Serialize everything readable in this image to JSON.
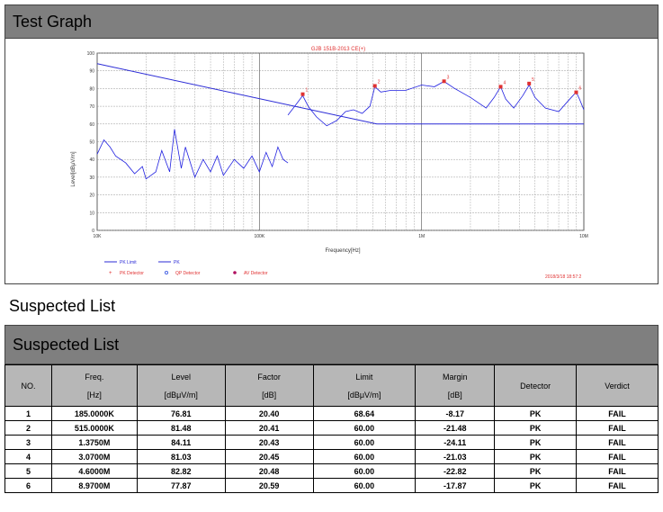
{
  "header": {
    "title": "Test Graph"
  },
  "chart_data": {
    "type": "line",
    "title": "GJB 151B-2013 CE(+)",
    "xlabel": "Frequency[Hz]",
    "ylabel": "Level[dBμV/m]",
    "xscale": "log",
    "xlim": [
      10000,
      10000000
    ],
    "ylim": [
      0,
      100
    ],
    "x_ticks": [
      10000,
      100000,
      1000000,
      10000000
    ],
    "x_tick_labels": [
      "10K",
      "100K",
      "1M",
      "10M"
    ],
    "y_ticks": [
      0,
      10,
      20,
      30,
      40,
      50,
      60,
      70,
      80,
      90,
      100
    ],
    "grid": true,
    "series": [
      {
        "name": "PK Limit",
        "color": "#2b2bd6",
        "x": [
          10000,
          530000,
          10000000
        ],
        "y": [
          94,
          60,
          60
        ]
      },
      {
        "name": "PK",
        "color": "#2020e0",
        "x": [
          10000,
          11000,
          12000,
          13000,
          15000,
          17000,
          19000,
          20000,
          23000,
          25000,
          28000,
          30000,
          33000,
          35000,
          40000,
          45000,
          50000,
          55000,
          60000,
          70000,
          80000,
          90000,
          100000,
          110000,
          120000,
          130000,
          140000,
          150000
        ],
        "y": [
          43,
          51,
          47,
          42,
          38,
          32,
          36,
          29,
          33,
          45,
          33,
          57,
          35,
          47,
          30,
          40,
          33,
          42,
          31,
          40,
          35,
          42,
          33,
          44,
          36,
          47,
          40,
          38
        ]
      },
      {
        "name": "PK",
        "color": "#2020e0",
        "x": [
          150000,
          165000,
          185000,
          200000,
          225000,
          260000,
          300000,
          340000,
          380000,
          430000,
          480000,
          515000,
          560000,
          650000,
          800000,
          1000000,
          1200000,
          1375000,
          1600000,
          2000000,
          2500000,
          2800000,
          3070000,
          3300000,
          3700000,
          4200000,
          4600000,
          5000000,
          5800000,
          7000000,
          8000000,
          8970000,
          9400000,
          10000000
        ],
        "y": [
          65,
          70,
          76,
          70,
          64,
          59,
          62,
          67,
          68,
          66,
          70,
          81,
          78,
          79,
          79,
          82,
          81,
          84,
          80,
          75,
          69,
          75,
          81,
          74,
          69,
          76,
          82,
          75,
          69,
          67,
          73,
          78,
          74,
          68
        ]
      }
    ],
    "markers": [
      {
        "label": "1",
        "x": 185000,
        "y": 76.81
      },
      {
        "label": "2",
        "x": 515000,
        "y": 81.48
      },
      {
        "label": "3",
        "x": 1375000,
        "y": 84.11
      },
      {
        "label": "4",
        "x": 3070000,
        "y": 81.03
      },
      {
        "label": "5",
        "x": 4600000,
        "y": 82.82
      },
      {
        "label": "6",
        "x": 8970000,
        "y": 77.87
      }
    ],
    "legend": [
      {
        "label": "PK Limit",
        "kind": "line",
        "color": "#2b2bd6"
      },
      {
        "label": "PK",
        "kind": "line",
        "color": "#2b2bd6"
      },
      {
        "label": "PK Detector",
        "kind": "cross",
        "color": "#e03030"
      },
      {
        "label": "QP Detector",
        "kind": "circle",
        "color": "#3050e0"
      },
      {
        "label": "AV Detector",
        "kind": "dot",
        "color": "#b01060"
      }
    ],
    "legend_position": "bottom-left",
    "footnote": "2018/3/18 18:57:2"
  },
  "suspected": {
    "heading": "Suspected List",
    "bar_title": "Suspected List",
    "columns": [
      {
        "line1": "NO.",
        "line2": ""
      },
      {
        "line1": "Freq.",
        "line2": "[Hz]"
      },
      {
        "line1": "Level",
        "line2": "[dBμV/m]"
      },
      {
        "line1": "Factor",
        "line2": "[dB]"
      },
      {
        "line1": "Limit",
        "line2": "[dBμV/m]"
      },
      {
        "line1": "Margin",
        "line2": "[dB]"
      },
      {
        "line1": "Detector",
        "line2": ""
      },
      {
        "line1": "Verdict",
        "line2": ""
      }
    ],
    "rows": [
      [
        "1",
        "185.0000K",
        "76.81",
        "20.40",
        "68.64",
        "-8.17",
        "PK",
        "FAIL"
      ],
      [
        "2",
        "515.0000K",
        "81.48",
        "20.41",
        "60.00",
        "-21.48",
        "PK",
        "FAIL"
      ],
      [
        "3",
        "1.3750M",
        "84.11",
        "20.43",
        "60.00",
        "-24.11",
        "PK",
        "FAIL"
      ],
      [
        "4",
        "3.0700M",
        "81.03",
        "20.45",
        "60.00",
        "-21.03",
        "PK",
        "FAIL"
      ],
      [
        "5",
        "4.6000M",
        "82.82",
        "20.48",
        "60.00",
        "-22.82",
        "PK",
        "FAIL"
      ],
      [
        "6",
        "8.9700M",
        "77.87",
        "20.59",
        "60.00",
        "-17.87",
        "PK",
        "FAIL"
      ]
    ]
  }
}
